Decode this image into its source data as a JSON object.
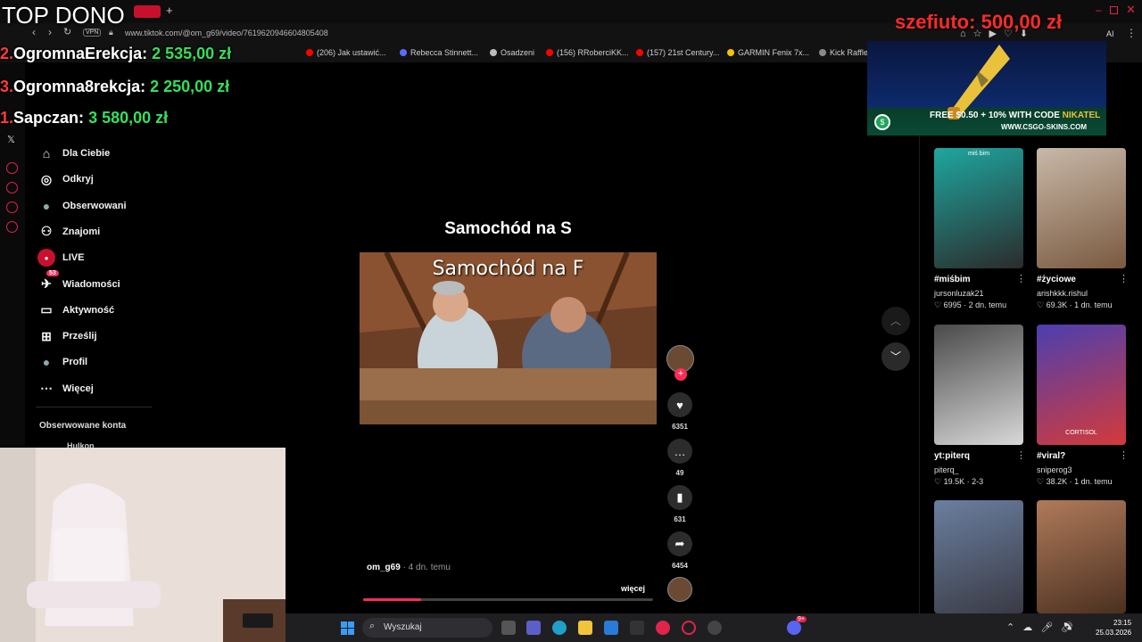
{
  "overlay": {
    "top_dono": "TOP DONO",
    "leaderboard": [
      {
        "rank": "2.",
        "name": "OgromnaErekcja:",
        "amount": "2 535,00 zł"
      },
      {
        "rank": "3.",
        "name": "Ogromna8rekcja:",
        "amount": "2 250,00 zł"
      },
      {
        "rank": "1.",
        "name": "Sapczan:",
        "amount": "3 580,00 zł"
      }
    ],
    "latest_dono": {
      "name": "szefiuto:",
      "amount": "500,00 zł"
    },
    "ad": {
      "line1": "FREE $0.50 + 10% WITH CODE",
      "code": "NIKATEL",
      "line2": "WWW.CSGO-SKINS.COM"
    }
  },
  "browser": {
    "url": "www.tiktok.com/@om_g69/video/7619620946604805408",
    "vpn": "VPN",
    "ai_label": "AI",
    "bookmarks": [
      {
        "label": "(206) Jak ustawić...",
        "color": "#ff0000"
      },
      {
        "label": "Rebecca Stinnett...",
        "color": "#5a6bff"
      },
      {
        "label": "Osadzeni",
        "color": "#bbbbbb"
      },
      {
        "label": "(156) RRoberciKK...",
        "color": "#ff0000"
      },
      {
        "label": "(157) 21st Century...",
        "color": "#ff0000"
      },
      {
        "label": "GARMIN Fenix 7x...",
        "color": "#f5c400"
      },
      {
        "label": "Kick Raffle",
        "color": "#888888"
      }
    ]
  },
  "nav": {
    "items": [
      {
        "label": "Dla Ciebie",
        "icon": "home-icon"
      },
      {
        "label": "Odkryj",
        "icon": "compass-icon"
      },
      {
        "label": "Obserwowani",
        "icon": "avatar-icon"
      },
      {
        "label": "Znajomi",
        "icon": "friends-icon"
      },
      {
        "label": "LIVE",
        "icon": "live-icon"
      },
      {
        "label": "Wiadomości",
        "icon": "messages-icon",
        "badge": "53"
      },
      {
        "label": "Aktywność",
        "icon": "activity-icon"
      },
      {
        "label": "Prześlij",
        "icon": "upload-icon"
      },
      {
        "label": "Profil",
        "icon": "profile-icon"
      },
      {
        "label": "Więcej",
        "icon": "more-icon"
      }
    ],
    "followed_heading": "Obserwowane konta",
    "followed_first": "Hulkon"
  },
  "video": {
    "title": "Samochód na S",
    "caption": "Samochód na F",
    "author": "om_g69",
    "posted": "· 4 dn. temu",
    "more": "więcej",
    "progress": 0.2,
    "actions": {
      "likes": "6351",
      "comments": "49",
      "saves": "631",
      "shares": "6454"
    }
  },
  "cards": [
    {
      "title": "#miśbim",
      "author": "jursonluzak21",
      "likes": "6995",
      "age": "2 dn. temu",
      "overlay": "miś bim",
      "colors": [
        "#1ea7a0",
        "#2b2b2b"
      ]
    },
    {
      "title": "#życiowe",
      "author": "arishkkk.rishul",
      "likes": "69.3K",
      "age": "1 dn. temu",
      "overlay": "",
      "colors": [
        "#c8b8a8",
        "#7a5a40"
      ]
    },
    {
      "title": "yt:piterq",
      "author": "piterq_",
      "likes": "19.5K",
      "age": "2-3",
      "overlay": "",
      "colors": [
        "#4a4a4a",
        "#d8d8d8"
      ]
    },
    {
      "title": "#viral?",
      "author": "sniperog3",
      "likes": "38.2K",
      "age": "1 dn. temu",
      "overlay": "CORTISOL",
      "colors": [
        "#4b3fb0",
        "#d43a3a"
      ]
    },
    {
      "title": "",
      "author": "",
      "likes": "",
      "age": "",
      "overlay": "",
      "colors": [
        "#6a7fa0",
        "#3a3a44"
      ]
    },
    {
      "title": "",
      "author": "",
      "likes": "",
      "age": "",
      "overlay": "",
      "colors": [
        "#b07a5a",
        "#4a3020"
      ]
    }
  ],
  "taskbar": {
    "search_placeholder": "Wyszukaj",
    "time": "23:15",
    "date": "25.03.2026",
    "badge": "9+"
  }
}
